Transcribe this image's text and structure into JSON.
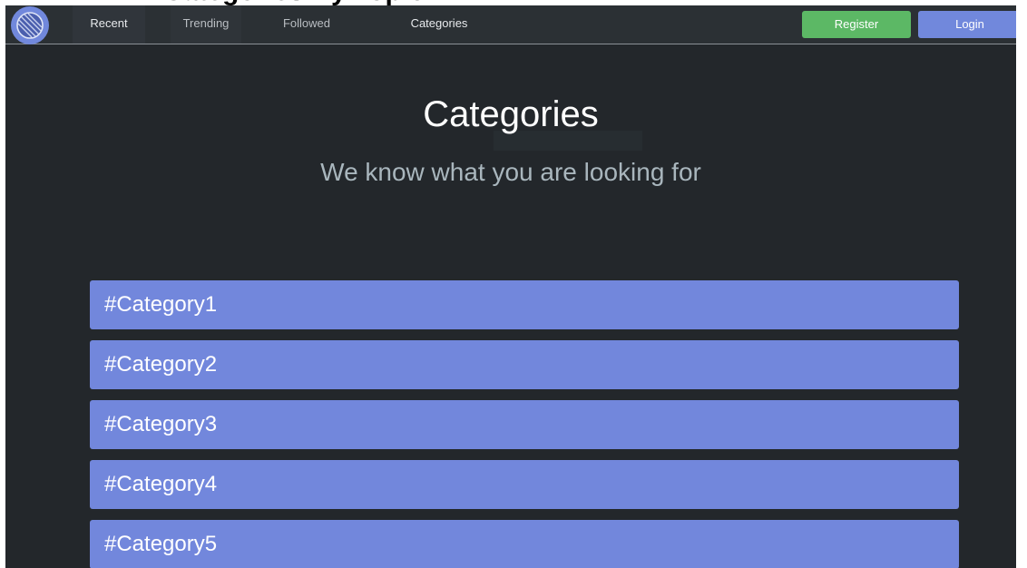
{
  "page_heading": "Categories By Topic",
  "nav": {
    "items": [
      {
        "label": "Recent"
      },
      {
        "label": "Trending"
      },
      {
        "label": "Followed"
      },
      {
        "label": "Categories"
      }
    ]
  },
  "auth": {
    "register_label": "Register",
    "login_label": "Login"
  },
  "hero": {
    "title": "Categories",
    "subtitle": "We know what you are looking for"
  },
  "categories": [
    {
      "label": "#Category1"
    },
    {
      "label": "#Category2"
    },
    {
      "label": "#Category3"
    },
    {
      "label": "#Category4"
    },
    {
      "label": "#Category5"
    }
  ],
  "colors": {
    "background": "#23272b",
    "navbar": "#2b3034",
    "accent": "#7287dc",
    "register": "#5cb865"
  },
  "icons": {
    "logo": "globe-logo-icon"
  }
}
